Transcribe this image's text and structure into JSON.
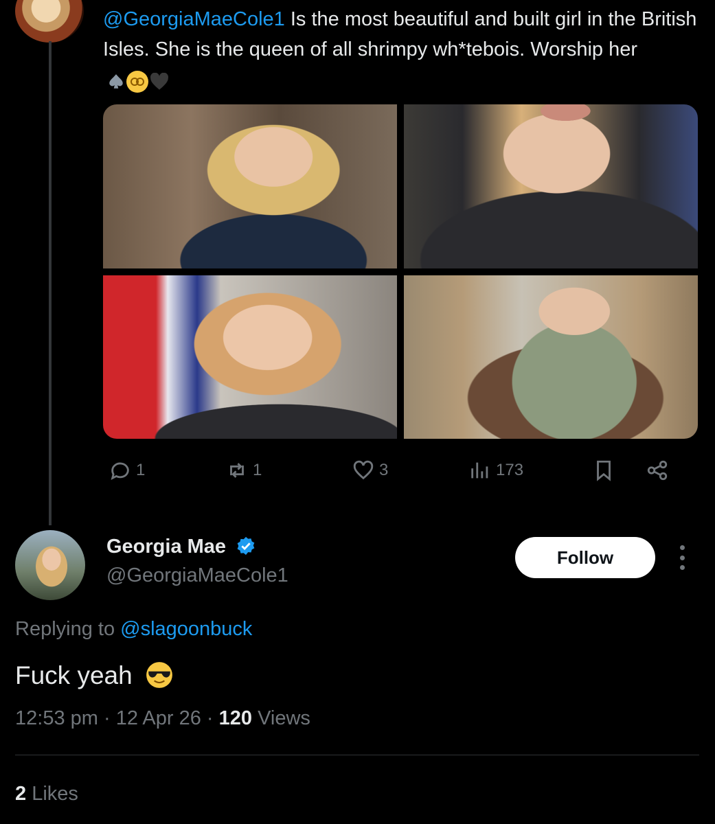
{
  "parent_tweet": {
    "mention": "@GeorgiaMaeCole1",
    "text": " Is the most beautiful and built girl in the British Isles. She is the queen of all shrimpy wh*tebois. Worship her",
    "emoji_icons": [
      "spade-icon",
      "woozy-face-icon",
      "black-heart-icon"
    ],
    "photos": [
      "photo-1",
      "photo-2",
      "photo-3",
      "photo-4"
    ],
    "actions": {
      "reply_count": "1",
      "retweet_count": "1",
      "like_count": "3",
      "view_count": "173"
    }
  },
  "reply": {
    "display_name": "Georgia Mae",
    "handle": "@GeorgiaMaeCole1",
    "follow_label": "Follow",
    "replying_prefix": "Replying to ",
    "replying_to": "@slagoonbuck",
    "text": "Fuck yeah",
    "time": "12:53 pm",
    "separator": " · ",
    "date": "12 Apr 26",
    "views_count": "120",
    "views_label": " Views",
    "likes_count": "2",
    "likes_label": " Likes"
  },
  "colors": {
    "background": "#000000",
    "text": "#e7e9ea",
    "muted": "#71767b",
    "link": "#1d9bf0",
    "follow_button": "#ffffff"
  }
}
